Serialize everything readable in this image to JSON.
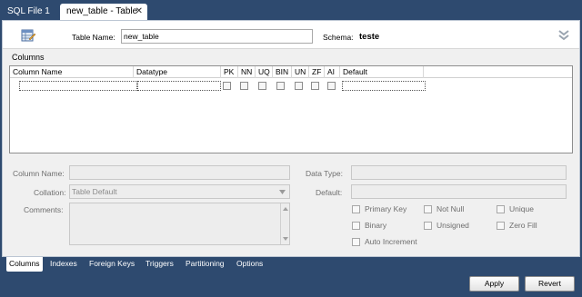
{
  "tabs": [
    {
      "label": "SQL File 1"
    },
    {
      "label": "new_table - Table",
      "close": "✕"
    }
  ],
  "header": {
    "table_name_label": "Table Name:",
    "table_name_value": "new_table",
    "schema_label": "Schema:",
    "schema_value": "teste"
  },
  "columns_section": {
    "title": "Columns",
    "headers": {
      "name": "Column Name",
      "datatype": "Datatype",
      "pk": "PK",
      "nn": "NN",
      "uq": "UQ",
      "bin": "BIN",
      "un": "UN",
      "zf": "ZF",
      "ai": "AI",
      "default": "Default"
    }
  },
  "details": {
    "column_name_label": "Column Name:",
    "collation_label": "Collation:",
    "collation_value": "Table Default",
    "comments_label": "Comments:",
    "data_type_label": "Data Type:",
    "default_label": "Default:",
    "options": {
      "primary_key": "Primary Key",
      "not_null": "Not Null",
      "unique": "Unique",
      "binary": "Binary",
      "unsigned": "Unsigned",
      "zero_fill": "Zero Fill",
      "auto_increment": "Auto Increment"
    }
  },
  "bottom_tabs": [
    "Columns",
    "Indexes",
    "Foreign Keys",
    "Triggers",
    "Partitioning",
    "Options"
  ],
  "buttons": {
    "apply": "Apply",
    "revert": "Revert"
  },
  "colors": {
    "chrome": "#2e4a6f",
    "panel": "#f0f0f0"
  }
}
